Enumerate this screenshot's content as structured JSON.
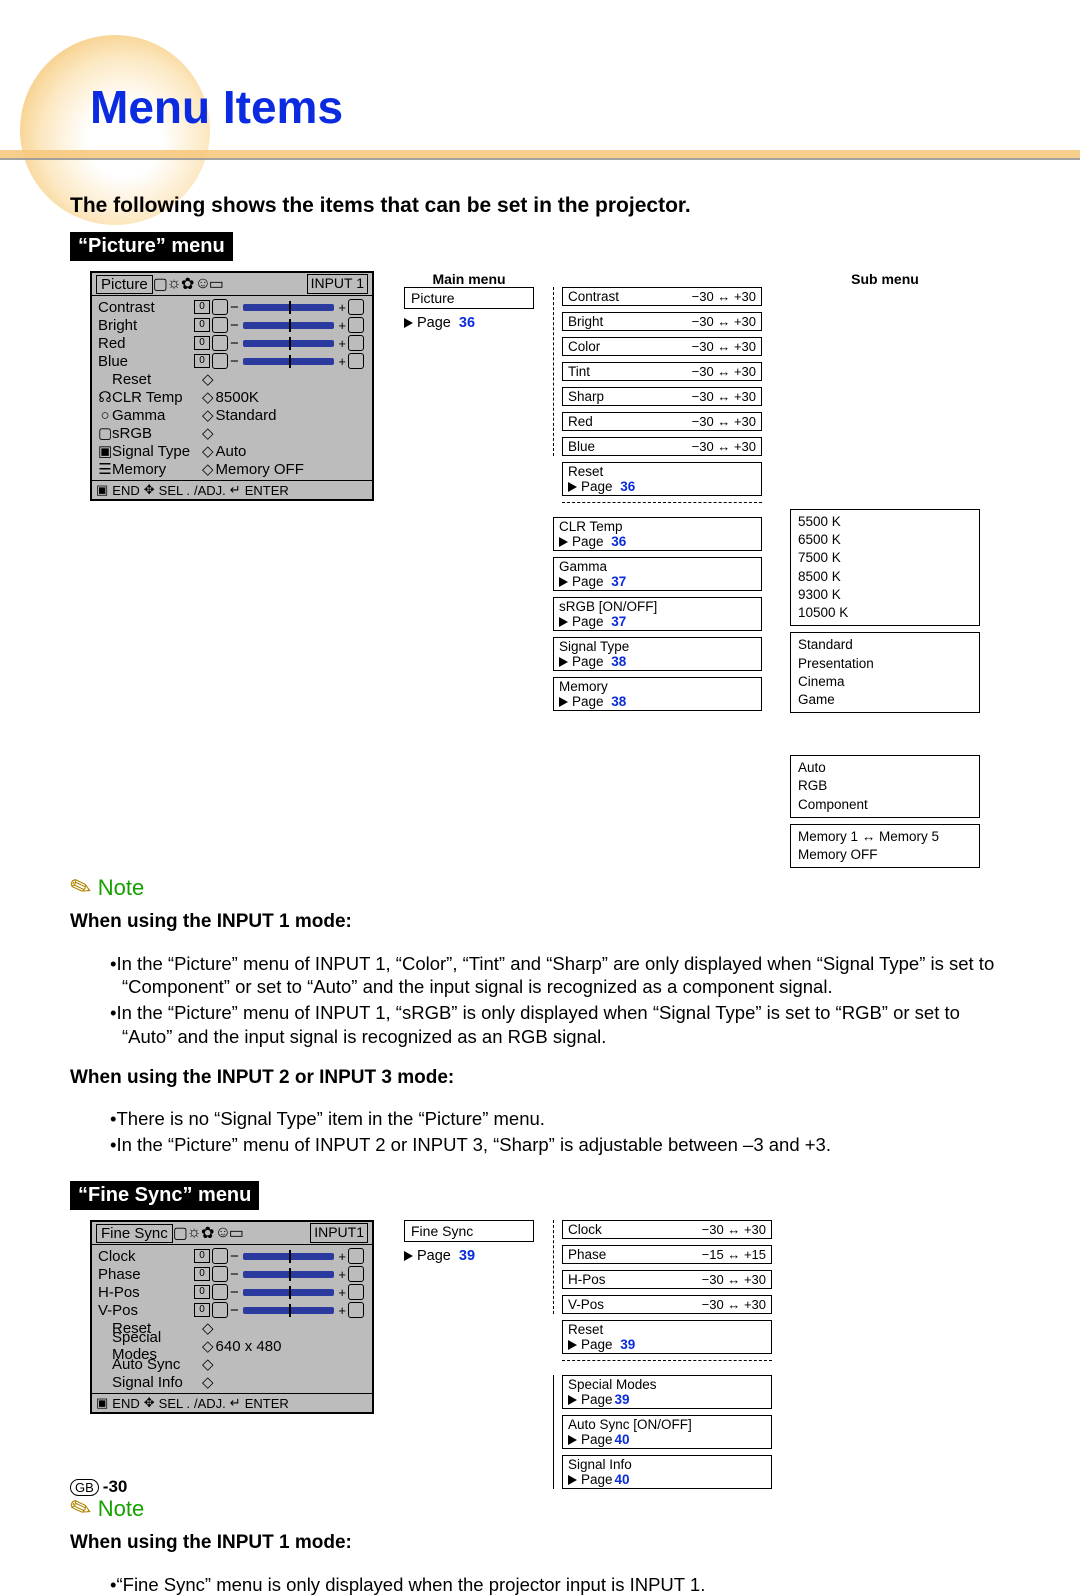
{
  "title": "Menu Items",
  "intro": "The following shows the items that can be set in the projector.",
  "section1_label": "“Picture” menu",
  "section2_label": "“Fine Sync” menu",
  "note_label": "Note",
  "headers": {
    "main": "Main menu",
    "sub": "Sub menu"
  },
  "osd_picture": {
    "tab": "Picture",
    "input": "INPUT 1",
    "rows_slider": [
      {
        "label": "Contrast",
        "val": "0"
      },
      {
        "label": "Bright",
        "val": "0"
      },
      {
        "label": "Red",
        "val": "0"
      },
      {
        "label": "Blue",
        "val": "0"
      }
    ],
    "rows_opts": [
      {
        "label": "Reset",
        "value": ""
      },
      {
        "label": "CLR Temp",
        "value": "8500K",
        "icon": "☊"
      },
      {
        "label": "Gamma",
        "value": "Standard",
        "icon": "○"
      },
      {
        "label": "sRGB",
        "value": "",
        "icon": "▢"
      },
      {
        "label": "Signal Type",
        "value": "Auto",
        "icon": "▣"
      },
      {
        "label": "Memory",
        "value": "Memory OFF",
        "icon": "☰"
      }
    ],
    "foot": [
      "END",
      "SEL .",
      "/ADJ.",
      "ENTER"
    ]
  },
  "main_picture": {
    "label": "Picture",
    "page": "36"
  },
  "picture_sliders": [
    {
      "name": "Contrast",
      "range": "−30 ↔ +30"
    },
    {
      "name": "Bright",
      "range": "−30 ↔ +30"
    },
    {
      "name": "Color",
      "range": "−30 ↔ +30"
    },
    {
      "name": "Tint",
      "range": "−30 ↔ +30"
    },
    {
      "name": "Sharp",
      "range": "−30 ↔ +30"
    },
    {
      "name": "Red",
      "range": "−30 ↔ +30"
    },
    {
      "name": "Blue",
      "range": "−30 ↔ +30"
    }
  ],
  "picture_reset": {
    "label": "Reset",
    "page": "36"
  },
  "clr_temp": {
    "label": "CLR Temp",
    "page": "36",
    "opts": [
      "5500 K",
      "6500 K",
      "7500 K",
      "8500 K",
      "9300 K",
      "10500 K"
    ]
  },
  "gamma": {
    "label": "Gamma",
    "page": "37",
    "opts": [
      "Standard",
      "Presentation",
      "Cinema",
      "Game"
    ]
  },
  "srgb": {
    "label": "sRGB [ON/OFF]",
    "page": "37"
  },
  "signal_type": {
    "label": "Signal Type",
    "page": "38",
    "opts": [
      "Auto",
      "RGB",
      "Component"
    ]
  },
  "memory": {
    "label": "Memory",
    "page": "38",
    "opts": [
      "Memory 1 ↔ Memory 5",
      "Memory OFF"
    ]
  },
  "notes1_head": "When using the INPUT 1 mode:",
  "notes1": [
    "In the “Picture” menu of INPUT 1, “Color”, “Tint” and “Sharp” are only displayed when “Signal Type” is set to “Component” or set to “Auto” and the input signal is recognized as a component signal.",
    "In the “Picture” menu of INPUT 1, “sRGB” is only displayed when “Signal Type” is set to “RGB” or set to “Auto” and the input signal is recognized as an RGB signal."
  ],
  "notes2_head": "When using the INPUT 2 or INPUT 3 mode:",
  "notes2": [
    "There is no “Signal Type” item in the “Picture” menu.",
    "In the “Picture” menu of INPUT 2 or INPUT 3, “Sharp” is adjustable between –3 and +3."
  ],
  "osd_finesync": {
    "tab": "Fine Sync",
    "input": "INPUT1",
    "rows_slider": [
      {
        "label": "Clock",
        "val": "0"
      },
      {
        "label": "Phase",
        "val": "0"
      },
      {
        "label": "H-Pos",
        "val": "0"
      },
      {
        "label": "V-Pos",
        "val": "0"
      }
    ],
    "rows_opts": [
      {
        "label": "Reset",
        "value": ""
      },
      {
        "label": "Special Modes",
        "value": "640 x 480"
      },
      {
        "label": "Auto Sync",
        "value": ""
      },
      {
        "label": "Signal Info",
        "value": ""
      }
    ],
    "foot": [
      "END",
      "SEL .",
      "/ADJ.",
      "ENTER"
    ]
  },
  "main_finesync": {
    "label": "Fine Sync",
    "page": "39"
  },
  "finesync_sliders": [
    {
      "name": "Clock",
      "range": "−30 ↔ +30"
    },
    {
      "name": "Phase",
      "range": "−15 ↔ +15"
    },
    {
      "name": "H-Pos",
      "range": "−30 ↔ +30"
    },
    {
      "name": "V-Pos",
      "range": "−30 ↔ +30"
    }
  ],
  "finesync_reset": {
    "label": "Reset",
    "page": "39"
  },
  "finesync_items": [
    {
      "label": "Special Modes",
      "page": "39"
    },
    {
      "label": "Auto Sync [ON/OFF]",
      "page": "40"
    },
    {
      "label": "Signal Info",
      "page": "40"
    }
  ],
  "notes3_head": "When using the INPUT 1 mode:",
  "notes3": [
    "“Fine Sync” menu is only displayed when the projector input is INPUT 1."
  ],
  "page_no_prefix": "GB",
  "page_no": "-30",
  "page_word": "Page"
}
